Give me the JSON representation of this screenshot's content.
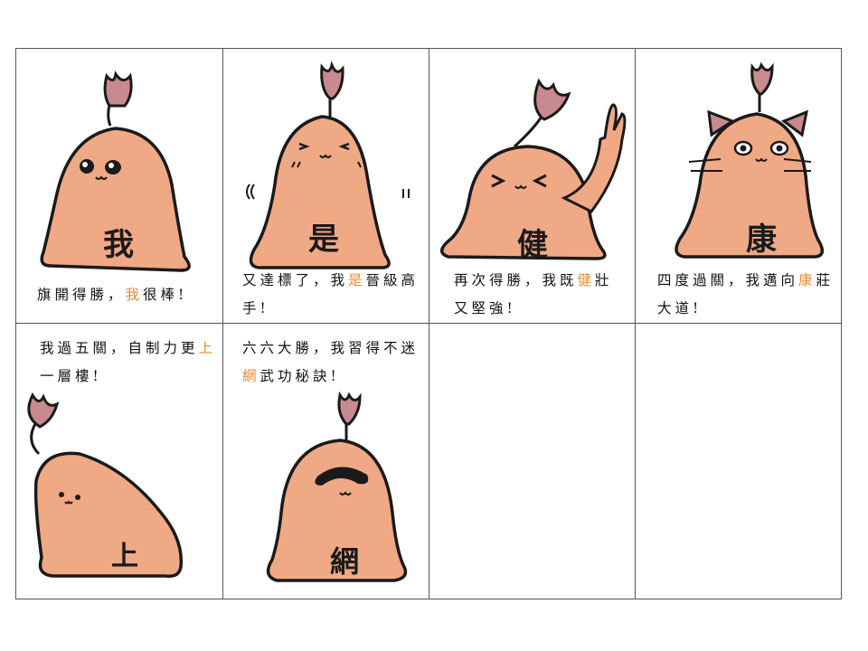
{
  "colors": {
    "body": "#f0a985",
    "bodyShade": "#e0906c",
    "outline": "#1a1a1a",
    "flower": "#c98a8f",
    "flowerDark": "#7a4a50",
    "highlight": "#e98a2f",
    "grid": "#555555"
  },
  "cells": [
    {
      "char": "我",
      "caption": {
        "pre": "旗開得勝，",
        "hl": "我",
        "post": "很棒!"
      }
    },
    {
      "char": "是",
      "caption": {
        "pre": "又達標了，我",
        "hl": "是",
        "post": "晉級高手!"
      }
    },
    {
      "char": "健",
      "caption": {
        "pre": "再次得勝，我既",
        "hl": "健",
        "post": "壯又堅強!"
      }
    },
    {
      "char": "康",
      "caption": {
        "pre": "四度過關，我邁向",
        "hl": "康",
        "post": "莊大道!"
      }
    },
    {
      "char": "上",
      "caption": {
        "pre": "我過五關，自制力更",
        "hl": "上",
        "post": "一層樓!"
      }
    },
    {
      "char": "網",
      "caption": {
        "pre": "六六大勝，我習得不迷",
        "hl": "網",
        "post": "武功秘訣!"
      }
    }
  ]
}
